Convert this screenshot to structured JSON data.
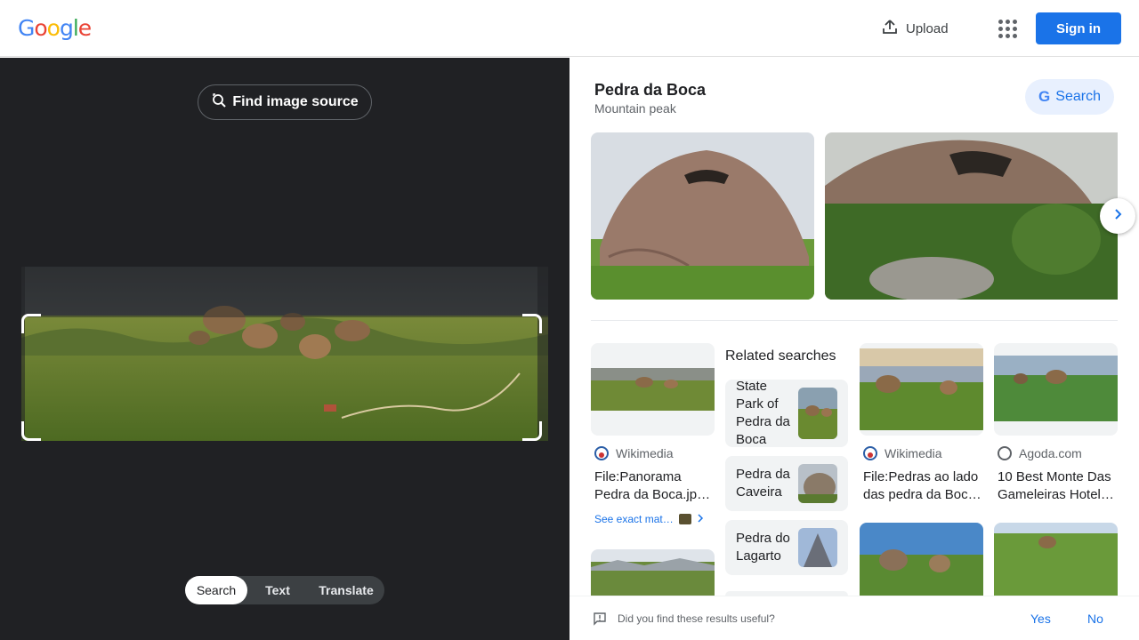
{
  "header": {
    "logo_letters": [
      "G",
      "o",
      "o",
      "g",
      "l",
      "e"
    ],
    "logo_colors": [
      "#4285F4",
      "#EA4335",
      "#FBBC05",
      "#4285F4",
      "#34A853",
      "#EA4335"
    ],
    "upload_label": "Upload",
    "signin_label": "Sign in"
  },
  "left": {
    "find_source_label": "Find image source",
    "modes": [
      {
        "label": "Search",
        "active": true
      },
      {
        "label": "Text",
        "active": false
      },
      {
        "label": "Translate",
        "active": false
      }
    ]
  },
  "entity": {
    "title": "Pedra da Boca",
    "subtitle": "Mountain peak",
    "search_label": "Search"
  },
  "cards": [
    {
      "source": "Wikimedia",
      "title": "File:Panorama Pedra da Boca.jp…",
      "see_exact": "See exact mat…"
    },
    {
      "source": "Wikimedia",
      "title": "File:Pedras ao lado das pedra da Boc…"
    },
    {
      "source": "Agoda.com",
      "title": "10 Best Monte Das Gameleiras Hotel…"
    }
  ],
  "related": {
    "title": "Related searches",
    "items": [
      {
        "label": "State Park of Pedra da Boca"
      },
      {
        "label": "Pedra da Caveira"
      },
      {
        "label": "Pedra do Lagarto"
      }
    ]
  },
  "feedback": {
    "question": "Did you find these results useful?",
    "yes": "Yes",
    "no": "No"
  },
  "colors": {
    "accent": "#1a73e8",
    "dark_panel": "#202124"
  }
}
